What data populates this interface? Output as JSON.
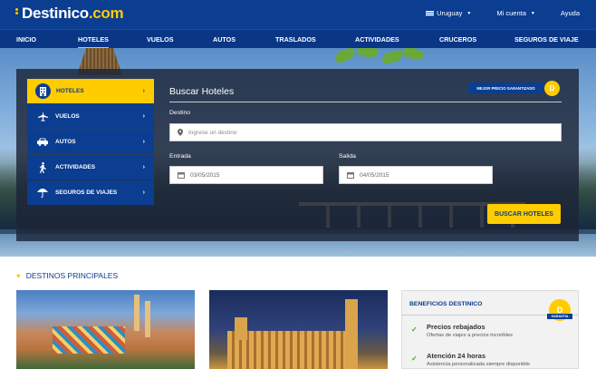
{
  "header": {
    "logo_text": "Destinico",
    "logo_suffix": ".com",
    "country": "Uruguay",
    "account": "Mi cuenta",
    "help": "Ayuda"
  },
  "nav": {
    "items": [
      "INICIO",
      "HOTELES",
      "VUELOS",
      "AUTOS",
      "TRASLADOS",
      "ACTIVIDADES",
      "CRUCEROS",
      "SEGUROS DE VIAJE"
    ],
    "active": "HOTELES"
  },
  "side_menu": {
    "items": [
      {
        "label": "HOTELES",
        "icon": "hotel-icon",
        "active": true
      },
      {
        "label": "VUELOS",
        "icon": "plane-icon",
        "active": false
      },
      {
        "label": "AUTOS",
        "icon": "car-icon",
        "active": false
      },
      {
        "label": "ACTIVIDADES",
        "icon": "walker-icon",
        "active": false
      },
      {
        "label": "SEGUROS DE VIAJES",
        "icon": "umbrella-icon",
        "active": false
      }
    ]
  },
  "search_form": {
    "title": "Buscar Hoteles",
    "badge": "MEJOR PRECIO GARANTIZADO",
    "destination_label": "Destino",
    "destination_placeholder": "Ingrese un destino",
    "checkin_label": "Entrada",
    "checkin_value": "03/05/2015",
    "checkout_label": "Salida",
    "checkout_value": "04/05/2015",
    "submit": "BUSCAR HOTELES"
  },
  "destinations": {
    "title": "DESTINOS PRINCIPALES"
  },
  "benefits": {
    "title": "BENEFICIOS DESTINICO",
    "seal_letter": "D",
    "seal_text": "GARANTIA",
    "items": [
      {
        "title": "Precios rebajados",
        "subtitle": "Ofertas de viajes a precios increíbles"
      },
      {
        "title": "Atención 24 horas",
        "subtitle": "Asistencia personalizada siempre disponible"
      }
    ]
  },
  "colors": {
    "brand_blue": "#0b3d91",
    "accent_yellow": "#ffcc00",
    "check_green": "#4aa32d"
  }
}
